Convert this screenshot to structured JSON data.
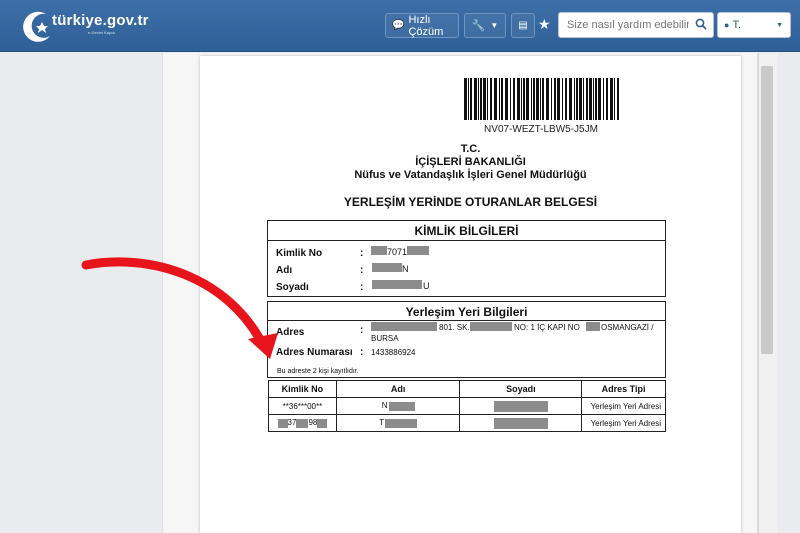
{
  "header": {
    "logo_text": "türkiye.gov.tr",
    "logo_sub": "e-Devlet Kapısı",
    "quick_solution_label": "Hızlı Çözüm",
    "search_placeholder": "Size nasıl yardım edebilirim?",
    "user_label": "T."
  },
  "document": {
    "barcode_code": "NV07-WEZT-LBW5-J5JM",
    "heading_tc": "T.C.",
    "heading_ministry": "İÇİŞLERİ BAKANLIĞI",
    "heading_directorate": "Nüfus ve Vatandaşlık İşleri Genel Müdürlüğü",
    "document_title": "YERLEŞİM YERİNDE OTURANLAR BELGESİ",
    "identity": {
      "section_title": "KİMLİK BİLGİLERİ",
      "id_label": "Kimlik No",
      "id_value": "7071",
      "name_label": "Adı",
      "name_value": "N",
      "surname_label": "Soyadı",
      "surname_value": "U"
    },
    "residence": {
      "section_title": "Yerleşim Yeri Bilgileri",
      "address_label": "Adres",
      "address_part1": "801. SK.",
      "address_part2": "NO: 1  İÇ KAPI NO",
      "address_part3": "OSMANGAZİ /",
      "address_city": "BURSA",
      "address_number_label": "Adres Numarası",
      "address_number_value": "1433886924"
    },
    "note": "Bu adreste 2 kişi kayıtlıdır.",
    "colon": ":",
    "residents_table": {
      "headers": [
        "Kimlik No",
        "Adı",
        "Soyadı",
        "Adres Tipi"
      ],
      "rows": [
        {
          "id": "**36***00**",
          "name": "N",
          "surname": "",
          "type": "Yerleşim Yeri Adresi"
        },
        {
          "id_part1": "37",
          "id_part2": "98",
          "name": "T",
          "surname": "",
          "type": "Yerleşim Yeri Adresi"
        }
      ]
    }
  },
  "colors": {
    "header_blue": "#2f5f97",
    "annotation_arrow": "#e8141b",
    "redaction_gray": "#8c8c8c"
  }
}
